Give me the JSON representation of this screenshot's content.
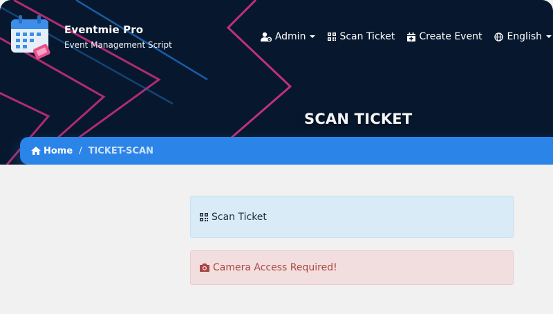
{
  "brand": {
    "title": "Eventmie Pro",
    "subtitle": "Event Management Script",
    "logo_icon": "calendar-ticket-icon"
  },
  "nav": {
    "items": [
      {
        "label": "Admin",
        "icon": "user-gear-icon",
        "dropdown": true
      },
      {
        "label": "Scan Ticket",
        "icon": "qrcode-icon",
        "dropdown": false
      },
      {
        "label": "Create Event",
        "icon": "calendar-plus-icon",
        "dropdown": false
      },
      {
        "label": "English",
        "icon": "globe-icon",
        "dropdown": true
      }
    ]
  },
  "hero": {
    "title": "SCAN TICKET"
  },
  "breadcrumb": {
    "home_label": "Home",
    "separator": "/",
    "current": "TICKET-SCAN"
  },
  "panels": {
    "scan_label": "Scan Ticket",
    "camera_message": "Camera Access Required!"
  },
  "colors": {
    "hero_bg": "#07182e",
    "accent": "#2b84e8",
    "info_bg": "#d9ebf7",
    "danger_bg": "#f2dede",
    "danger_text": "#a94442",
    "stripe_pink": "#c2307a",
    "stripe_blue": "#1f6fc0"
  }
}
